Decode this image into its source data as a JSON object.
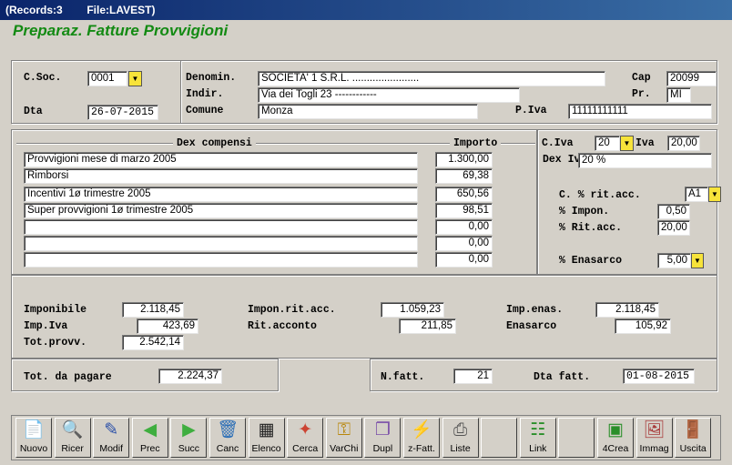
{
  "window": {
    "title": "(Records:3        File:LAVEST)"
  },
  "app": {
    "title": "Preparaz. Fatture Provvigioni"
  },
  "header": {
    "csoc": {
      "label": "C.Soc.",
      "value": "0001"
    },
    "dta": {
      "label": "Dta",
      "value": "26-07-2015"
    },
    "denomin": {
      "label": "Denomin.",
      "value": "SOCIETA' 1 S.R.L. ......................."
    },
    "indir": {
      "label": "Indir.",
      "value": "Via dei Togli  23 ------------"
    },
    "comune": {
      "label": "Comune",
      "value": "Monza"
    },
    "cap": {
      "label": "Cap",
      "value": "20099"
    },
    "pr": {
      "label": "Pr.",
      "value": "MI"
    },
    "piva": {
      "label": "P.Iva",
      "value": "11111111111"
    }
  },
  "compensi": {
    "col_dex": "Dex compensi",
    "col_importo": "Importo",
    "rows": [
      {
        "dex": "Provvigioni mese di marzo 2005",
        "importo": "1.300,00"
      },
      {
        "dex": "Rimborsi",
        "importo": "69,38"
      },
      {
        "dex": "Incentivi 1ø trimestre 2005",
        "importo": "650,56"
      },
      {
        "dex": "Super provvigioni 1ø trimestre 2005",
        "importo": "98,51"
      },
      {
        "dex": "",
        "importo": "0,00"
      },
      {
        "dex": "",
        "importo": "0,00"
      },
      {
        "dex": "",
        "importo": "0,00"
      }
    ]
  },
  "iva": {
    "civa": {
      "label": "C.Iva",
      "value": "20"
    },
    "iva": {
      "label": "Iva",
      "value": "20,00"
    },
    "dexiva": {
      "label": "Dex Iv",
      "value": "20 %"
    },
    "cperc_rit": {
      "label": "C. % rit.acc.",
      "value": "A1"
    },
    "perc_impon": {
      "label": "% Impon.",
      "value": "0,50"
    },
    "perc_rit": {
      "label": "% Rit.acc.",
      "value": "20,00"
    },
    "perc_enasarco": {
      "label": "% Enasarco",
      "value": "5,00"
    }
  },
  "totals": {
    "imponibile": {
      "label": "Imponibile",
      "value": "2.118,45"
    },
    "imp_iva": {
      "label": "Imp.Iva",
      "value": "423,69"
    },
    "tot_provv": {
      "label": "Tot.provv.",
      "value": "2.542,14"
    },
    "impon_rit": {
      "label": "Impon.rit.acc.",
      "value": "1.059,23"
    },
    "rit_acconto": {
      "label": "Rit.acconto",
      "value": "211,85"
    },
    "imp_enas": {
      "label": "Imp.enas.",
      "value": "2.118,45"
    },
    "enasarco": {
      "label": "Enasarco",
      "value": "105,92"
    }
  },
  "footer": {
    "tot_pagare": {
      "label": "Tot. da pagare",
      "value": "2.224,37"
    },
    "nfatt": {
      "label": "N.fatt.",
      "value": "21"
    },
    "dtafatt": {
      "label": "Dta fatt.",
      "value": "01-08-2015"
    }
  },
  "toolbar": [
    {
      "label": "Nuovo",
      "icon": "new-document-icon",
      "glyph": "📄",
      "color": "#2a8f2a"
    },
    {
      "label": "Ricer",
      "icon": "magnifier-icon",
      "glyph": "🔍",
      "color": "#444"
    },
    {
      "label": "Modif",
      "icon": "edit-document-icon",
      "glyph": "✎",
      "color": "#2a4fa8"
    },
    {
      "label": "Prec",
      "icon": "arrow-left-icon",
      "glyph": "◀",
      "color": "#3fae3f"
    },
    {
      "label": "Succ",
      "icon": "arrow-right-icon",
      "glyph": "▶",
      "color": "#3fae3f"
    },
    {
      "label": "Canc",
      "icon": "trash-icon",
      "glyph": "🗑",
      "color": "#2d6fb7"
    },
    {
      "label": "Elenco",
      "icon": "list-table-icon",
      "glyph": "▦",
      "color": "#222"
    },
    {
      "label": "Cerca",
      "icon": "search-brush-icon",
      "glyph": "✦",
      "color": "#c43"
    },
    {
      "label": "VarChi",
      "icon": "keys-icon",
      "glyph": "⚿",
      "color": "#b8860b"
    },
    {
      "label": "Dupl",
      "icon": "duplicate-icon",
      "glyph": "❐",
      "color": "#7a4fa8"
    },
    {
      "label": "z-Fatt.",
      "icon": "zfatt-icon",
      "glyph": "⚡",
      "color": "#c8a800"
    },
    {
      "label": "Liste",
      "icon": "printer-icon",
      "glyph": "⎙",
      "color": "#555"
    },
    {
      "label": "",
      "icon": "blank-icon",
      "glyph": "",
      "color": "#000"
    },
    {
      "label": "Link",
      "icon": "network-link-icon",
      "glyph": "☷",
      "color": "#2a8f2a"
    },
    {
      "label": "",
      "icon": "blank-icon",
      "glyph": "",
      "color": "#000"
    },
    {
      "label": "4Crea",
      "icon": "create-form-icon",
      "glyph": "▣",
      "color": "#2a8f2a"
    },
    {
      "label": "Immag",
      "icon": "image-card-icon",
      "glyph": "🖼",
      "color": "#a83a3a"
    },
    {
      "label": "Uscita",
      "icon": "exit-door-icon",
      "glyph": "🚪",
      "color": "#c00"
    }
  ]
}
